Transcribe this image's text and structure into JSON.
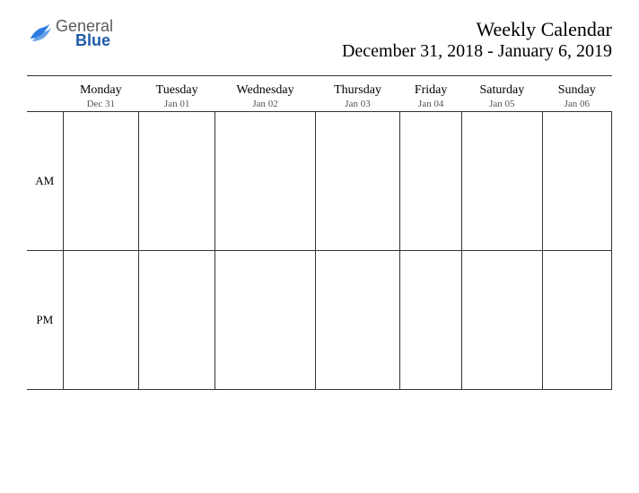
{
  "logo": {
    "general": "General",
    "blue": "Blue"
  },
  "header": {
    "title": "Weekly Calendar",
    "date_range": "December 31, 2018 - January 6, 2019"
  },
  "days": [
    {
      "name": "Monday",
      "date": "Dec 31"
    },
    {
      "name": "Tuesday",
      "date": "Jan 01"
    },
    {
      "name": "Wednesday",
      "date": "Jan 02"
    },
    {
      "name": "Thursday",
      "date": "Jan 03"
    },
    {
      "name": "Friday",
      "date": "Jan 04"
    },
    {
      "name": "Saturday",
      "date": "Jan 05"
    },
    {
      "name": "Sunday",
      "date": "Jan 06"
    }
  ],
  "periods": {
    "am": "AM",
    "pm": "PM"
  }
}
